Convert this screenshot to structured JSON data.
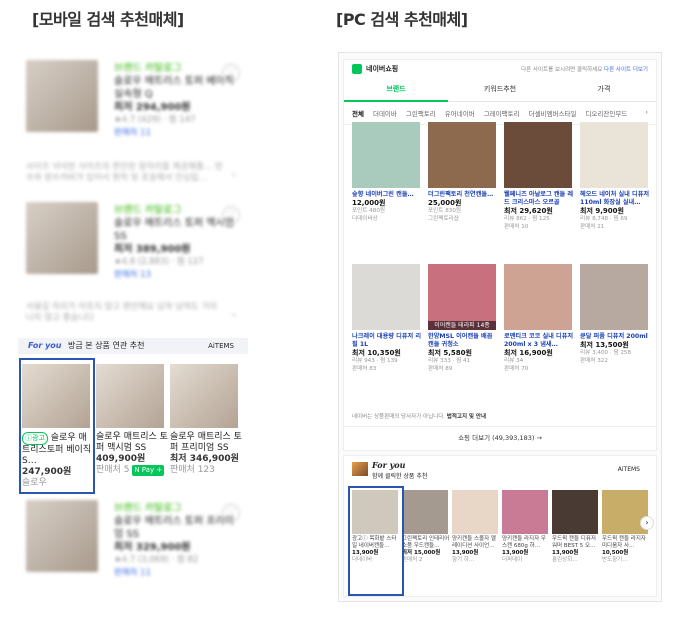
{
  "headings": {
    "mobile": "[모바일 검색 추천매체]",
    "pc": "[PC 검색 추천매체]"
  },
  "mobile": {
    "items": [
      {
        "brand": "브랜드 카탈로그",
        "title": "슬로우 매트리스 토퍼 베이직 실속형 Q",
        "price": "최저 294,900원",
        "rating": "★4.7 (429) · 찜 147",
        "sellers": "판매처 11"
      },
      {
        "brand": "브랜드 카탈로그",
        "title": "슬로우 매트리스 토퍼 맥시멈 SS",
        "price": "최저 389,900원",
        "rating": "★4.8 (2,883) · 찜 127",
        "sellers": "판매처 13"
      },
      {
        "brand": "브랜드 카탈로그",
        "title": "슬로우 매트리스 토퍼 프리미엄 SS",
        "price": "최저 329,900원",
        "rating": "★4.7 (3,069) · 찜 82",
        "sellers": "판매처 11"
      }
    ],
    "descs": [
      "사이즈 넉넉한 사이즈의 편안한 잠자리를 제공해줄… 방수와 방수커버가 있어서 편히 및 포옹해서 안심입…",
      "서울길 하리가 아프지 않고 편안해요 넘쳐 넘쳐도 거의 나지 않고 좋습니다"
    ],
    "foryou": {
      "logo": "For you",
      "label": "방금 본 상품 연관 추천",
      "aitems": "AiTEMS",
      "cards": [
        {
          "ad": "ⓘ광고",
          "title": "슬로우 매트리스토퍼 베이직 S…",
          "price": "247,900원",
          "seller": "슬로우"
        },
        {
          "title": "슬로우 매트리스 토퍼 맥시멈 SS",
          "price": "409,900원",
          "seller": "판매처 5",
          "pay": "N Pay +"
        },
        {
          "title": "슬로우 매트리스 토퍼 프리미엄 SS",
          "price": "최저 346,900원",
          "seller": "판매처 123"
        }
      ]
    }
  },
  "pc": {
    "logo": "네이버쇼핑",
    "notice": "다른 사이트를 보시려면 클릭하세요",
    "notice_link": "다른 사이트 더보기",
    "tabs": [
      "브랜드",
      "키워드추천",
      "가격"
    ],
    "cats": [
      "전체",
      "더데이바",
      "그린팩토리",
      "유어네이버",
      "그레이팩토리",
      "더셀비엠버스타일",
      "디오리잔인무드"
    ],
    "products": [
      {
        "title": "숲향 네이버그린 캔들…",
        "price": "12,000원",
        "meta": "포인트 480원",
        "seller": "더데이바상",
        "color": "#a9cbbd"
      },
      {
        "title": "더그린팩토리 천연캔들…",
        "price": "25,000원",
        "meta": "포인트 830원",
        "seller": "그린팩토리샵",
        "color": "#8d6a4e"
      },
      {
        "title": "웰페니즈 아날로그 캔들 레드 크리스마스 오르골",
        "price": "최저 29,620원",
        "meta": "리뷰 862 · 찜 125",
        "seller": "판매처 10",
        "color": "#6b4b3a"
      },
      {
        "title": "헤오드 네이처 실내 디퓨저 110ml 화장실 실내…",
        "price": "최저 9,900원",
        "meta": "리뷰 8,748 · 찜 69",
        "seller": "판매처 21",
        "color": "#e9e3d8"
      },
      {
        "title": "나크레이 대용량 디퓨저 리필 1L",
        "price": "최저 10,350원",
        "meta": "리뷰 943 · 찜 139",
        "seller": "판매처 83",
        "color": "#dcdad6"
      },
      {
        "title": "한양MSL 이어캔들 배꼽캔들 귀청소",
        "price": "최저 5,580원",
        "meta": "리뷰 333 · 찜 41",
        "seller": "판매처 89",
        "color": "#c9707f",
        "overlay": "이어캔들 테라피 14종"
      },
      {
        "title": "로맨티크 코코 실내 디퓨저 200ml x 3 냄새…",
        "price": "최저 16,900원",
        "meta": "리뷰 34",
        "seller": "판매처 70",
        "color": "#cfa393"
      },
      {
        "title": "큔달 퍼퓸 디퓨저 200ml",
        "price": "최저 13,500원",
        "meta": "리뷰 3,400 · 찜 258",
        "seller": "판매처 322",
        "color": "#b7a8a0"
      }
    ],
    "disclaimer": "네이버는 상품판매의 당사자가 아닙니다.",
    "disclaimer_link": "법적고지 및 안내",
    "more": "쇼핑 더보기 (49,393,183) →",
    "foryou": {
      "logo": "For you",
      "label": "함께 클릭한 상품 추천",
      "aitems": "AiTEMS",
      "cards": [
        {
          "title": "광고ⓘ 목화밭 스타일 네이버캔들…",
          "price": "13,900원",
          "seller": "더데이바",
          "color": "#cfc9bd"
        },
        {
          "title": "그린팩토리 인테리어 소품 우드캔들…",
          "price": "최저 15,000원",
          "seller": "판매처 2",
          "color": "#a59a90"
        },
        {
          "title": "양키캔들 스몰자 멜레이디션 사이언…",
          "price": "13,900원",
          "seller": "향기 하…",
          "color": "#e8d6c6"
        },
        {
          "title": "양키캔들 라지자 우스캔 680g 하…",
          "price": "13,900원",
          "seller": "더퍼데이",
          "color": "#c97b95"
        },
        {
          "title": "우드윅 캔들 디퓨저 워머 BEST 5 오…",
          "price": "13,900원",
          "seller": "홀린상회…",
          "color": "#4a3a34"
        },
        {
          "title": "우드윅 캔들 라지자 미디움자 사…",
          "price": "10,500원",
          "seller": "반도향기…",
          "color": "#c8ad68"
        }
      ]
    }
  }
}
